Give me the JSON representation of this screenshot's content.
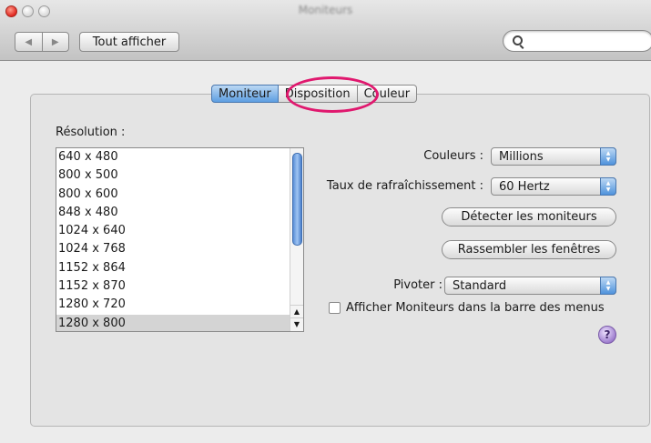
{
  "window": {
    "title": "Moniteurs"
  },
  "toolbar": {
    "back_label": "◀",
    "forward_label": "▶",
    "show_all_label": "Tout afficher",
    "search": {
      "value": "",
      "placeholder": ""
    }
  },
  "tabs": [
    {
      "label": "Moniteur",
      "active": true
    },
    {
      "label": "Disposition",
      "active": false,
      "highlighted": true
    },
    {
      "label": "Couleur",
      "active": false
    }
  ],
  "resolution": {
    "label": "Résolution :",
    "items": [
      "640 x 480",
      "800 x 500",
      "800 x 600",
      "848 x 480",
      "1024 x 640",
      "1024 x 768",
      "1152 x 864",
      "1152 x 870",
      "1280 x 720",
      "1280 x 800"
    ],
    "selected": "1280 x 800"
  },
  "settings": {
    "colors_label": "Couleurs :",
    "colors_value": "Millions",
    "refresh_label": "Taux de rafraîchissement :",
    "refresh_value": "60 Hertz",
    "detect_label": "Détecter les moniteurs",
    "gather_label": "Rassembler les fenêtres",
    "rotate_label": "Pivoter :",
    "rotate_value": "Standard",
    "menubar_checkbox_label": "Afficher Moniteurs dans la barre des menus",
    "menubar_checked": false,
    "help_label": "?"
  },
  "colors": {
    "highlight_ring": "#e0186e",
    "selection_blue": "#5d9ee2"
  }
}
